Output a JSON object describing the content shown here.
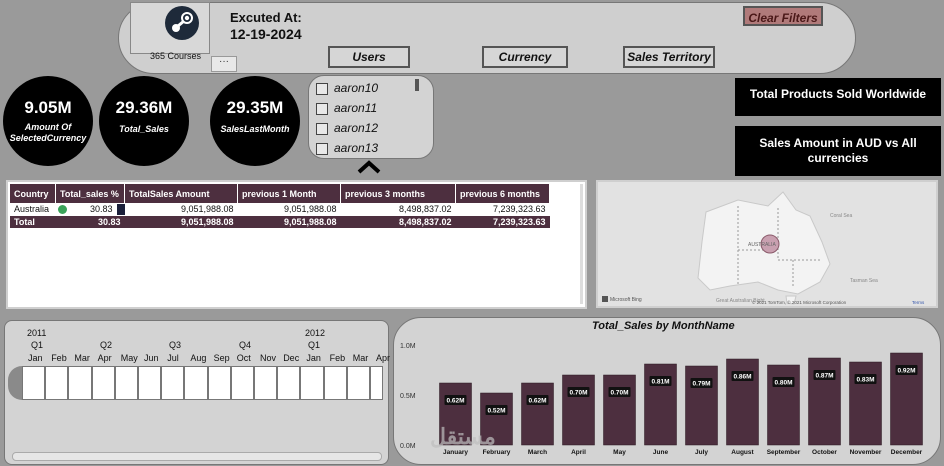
{
  "header": {
    "logo_caption": "365 Courses",
    "more_label": "···",
    "executed_label": "Excuted At:",
    "executed_date": "12-19-2024",
    "clear_filters": "Clear Filters",
    "slicers": [
      "Users",
      "Currency",
      "Sales Territory"
    ]
  },
  "kpis": [
    {
      "value": "9.05M",
      "label": "Amount Of SelectedCurrency"
    },
    {
      "value": "29.36M",
      "label": "Total_Sales"
    },
    {
      "value": "29.35M",
      "label": "SalesLastMonth"
    }
  ],
  "user_list": [
    "aaron10",
    "aaron11",
    "aaron12",
    "aaron13"
  ],
  "info_boxes": [
    "Total Products Sold Worldwide",
    "Sales Amount in AUD vs All currencies"
  ],
  "table": {
    "headers": [
      "Country",
      "Total_sales %",
      "TotalSales Amount",
      "previous 1 Month",
      "previous 3 months",
      "previous 6 months"
    ],
    "row": [
      "Australia",
      "30.83",
      "9,051,988.08",
      "9,051,988.08",
      "8,498,837.02",
      "7,239,323.63"
    ],
    "total": [
      "Total",
      "30.83",
      "9,051,988.08",
      "9,051,988.08",
      "8,498,837.02",
      "7,239,323.63"
    ],
    "status_color": "#3aa35a"
  },
  "map": {
    "labels": [
      "AUSTRALIA",
      "Coral Sea",
      "Tasman Sea",
      "Great Australian Bight"
    ],
    "credit": "© 2021 TomTom, © 2021 Microsoft Corporation",
    "terms": "Terms",
    "brand": "Microsoft Bing"
  },
  "timeline": {
    "years": [
      "2011",
      "2012"
    ],
    "quarters": [
      "Q1",
      "Q2",
      "Q3",
      "Q4",
      "Q1"
    ],
    "months": [
      "Jan",
      "Feb",
      "Mar",
      "Apr",
      "May",
      "Jun",
      "Jul",
      "Aug",
      "Sep",
      "Oct",
      "Nov",
      "Dec",
      "Jan",
      "Feb",
      "Mar",
      "Apr"
    ]
  },
  "chart_data": {
    "type": "bar",
    "title": "Total_Sales by MonthName",
    "categories": [
      "January",
      "February",
      "March",
      "April",
      "May",
      "June",
      "July",
      "August",
      "September",
      "October",
      "November",
      "December"
    ],
    "values": [
      0.62,
      0.52,
      0.62,
      0.7,
      0.7,
      0.81,
      0.79,
      0.86,
      0.8,
      0.87,
      0.83,
      0.92
    ],
    "data_labels": [
      "0.62M",
      "0.52M",
      "0.62M",
      "0.70M",
      "0.70M",
      "0.81M",
      "0.79M",
      "0.86M",
      "0.80M",
      "0.87M",
      "0.83M",
      "0.92M"
    ],
    "yticks": [
      "1.0M",
      "0.5M",
      "0.0M"
    ],
    "ylim": [
      0,
      1.0
    ],
    "bar_color": "#4d2f3f"
  },
  "watermark": "مستقل"
}
